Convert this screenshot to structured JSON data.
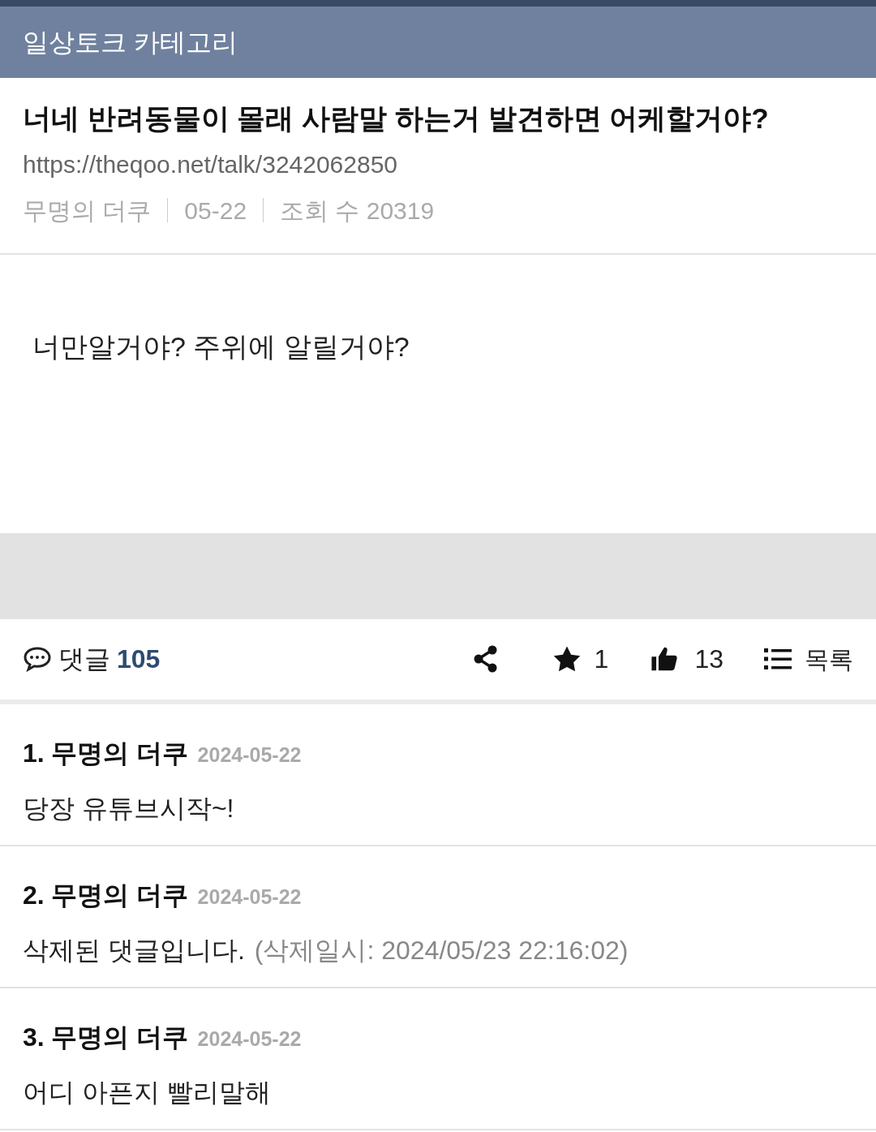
{
  "header": {
    "title": "일상토크 카테고리"
  },
  "post": {
    "title": "너네 반려동물이 몰래 사람말 하는거 발견하면 어케할거야?",
    "url": "https://theqoo.net/talk/3242062850",
    "meta": [
      "무명의 더쿠",
      "05-22",
      "조회 수 20319"
    ],
    "body": "너만알거야? 주위에 알릴거야?"
  },
  "actions": {
    "comments_label": "댓글",
    "comments_count": "105",
    "stars": "1",
    "likes": "13",
    "list_label": "목록"
  },
  "comments": [
    {
      "number": "1.",
      "author": "무명의 더쿠",
      "date": "2024-05-22",
      "text": "당장 유튜브시작~!"
    },
    {
      "number": "2.",
      "author": "무명의 더쿠",
      "date": "2024-05-22",
      "text": "삭제된 댓글입니다.",
      "note": "(삭제일시: 2024/05/23 22:16:02)"
    },
    {
      "number": "3.",
      "author": "무명의 더쿠",
      "date": "2024-05-22",
      "text": "어디 아픈지 빨리말해"
    }
  ]
}
